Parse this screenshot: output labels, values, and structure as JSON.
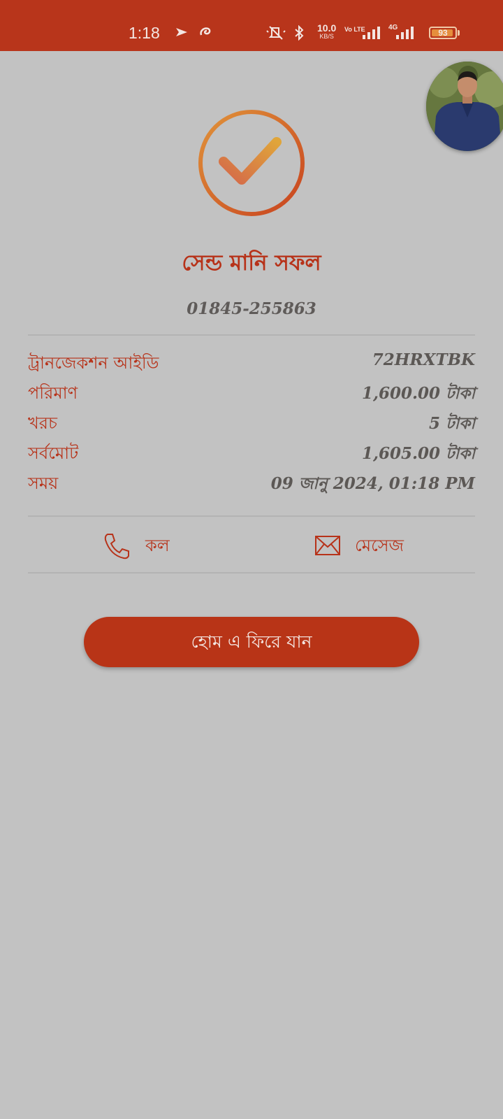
{
  "status_bar": {
    "time": "1:18",
    "net_speed": "10.0",
    "net_speed_unit": "KB/S",
    "volte": "Vo LTE",
    "network": "4G",
    "battery": "93",
    "battery_level": 0.93,
    "icons": [
      "navigation-icon",
      "notification-icon",
      "mute-icon",
      "bluetooth-icon",
      "signal-icon",
      "signal-4g-icon",
      "battery-icon"
    ]
  },
  "colors": {
    "brand": "#b8351b",
    "accent_orange": "#e58e3c",
    "background": "#c2c2c2"
  },
  "result": {
    "title": "সেন্ড মানি সফল",
    "phone": "01845-255863"
  },
  "details": [
    {
      "label": "ট্রানজেকশন আইডি",
      "value": "72HRXTBK"
    },
    {
      "label": "পরিমাণ",
      "value": "1,600.00 টাকা"
    },
    {
      "label": "খরচ",
      "value": "5 টাকা"
    },
    {
      "label": "সর্বমোট",
      "value": "1,605.00 টাকা"
    },
    {
      "label": "সময়",
      "value": "09 জানু 2024, 01:18 PM"
    }
  ],
  "actions": {
    "call_label": "কল",
    "message_label": "মেসেজ"
  },
  "home_button": "হোম এ ফিরে যান"
}
